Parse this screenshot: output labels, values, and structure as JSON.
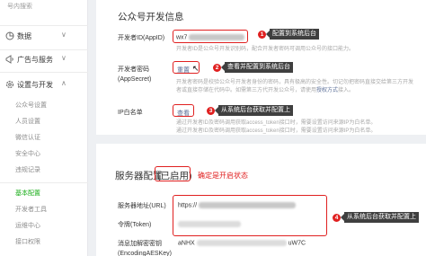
{
  "sidebar": {
    "top_item": "号内搜索",
    "groups": [
      {
        "label": "数据",
        "icon": "data-icon"
      },
      {
        "label": "广告与服务",
        "icon": "ads-icon"
      },
      {
        "label": "设置与开发",
        "icon": "settings-icon"
      }
    ],
    "sub_items": [
      "公众号设置",
      "人员设置",
      "微信认证",
      "安全中心",
      "违规记录"
    ],
    "dev_items": [
      "基本配置",
      "开发者工具",
      "运维中心",
      "接口权限"
    ],
    "active_item": "基本配置"
  },
  "dev_info": {
    "title": "公众号开发信息",
    "appid_label": "开发者ID(AppID)",
    "appid_value": "wx7",
    "appid_hint": "开发者ID是公众号开发识别码，配合开发者密码可调用公众号的接口能力。",
    "secret_label": "开发者密码(AppSecret)",
    "secret_action": "重置",
    "secret_hint_1": "开发者密码是校验公众号开发者身份的密码，具有极高的安全性。切记勿把密码直接交给第三方开",
    "secret_hint_2": "发者或直接存储在代码中。如需第三方代开发公众号，请使用",
    "secret_hint_link": "授权方式",
    "secret_hint_3": "接入。",
    "whitelist_label": "IP白名单",
    "whitelist_action": "查看",
    "whitelist_hint_1": "通过开发者ID及密码调用获取access_token接口时，需要设置访问来源IP为白名单。",
    "whitelist_hint_2": "通过开发者ID及密码调用获取access_token接口时，需要设置访问来源IP为白名单。"
  },
  "server_config": {
    "title": "服务器配置",
    "status": "(已启用)",
    "url_label": "服务器地址(URL)",
    "url_value": "https://",
    "token_label": "令牌(Token)",
    "aes_label": "消息加解密密钥(EncodingAESKey)",
    "aes_value_start": "aNHX",
    "aes_value_end": "uW7C"
  },
  "annotations": {
    "n1": "1",
    "t1": "配置到系统后台",
    "n2": "2",
    "t2": "查看并配置到系统后台",
    "n3": "3",
    "t3": "从系统后台获取并配置上",
    "status_note": "确定是开启状态",
    "n4": "4",
    "t4": "从系统后台获取并配置上"
  }
}
